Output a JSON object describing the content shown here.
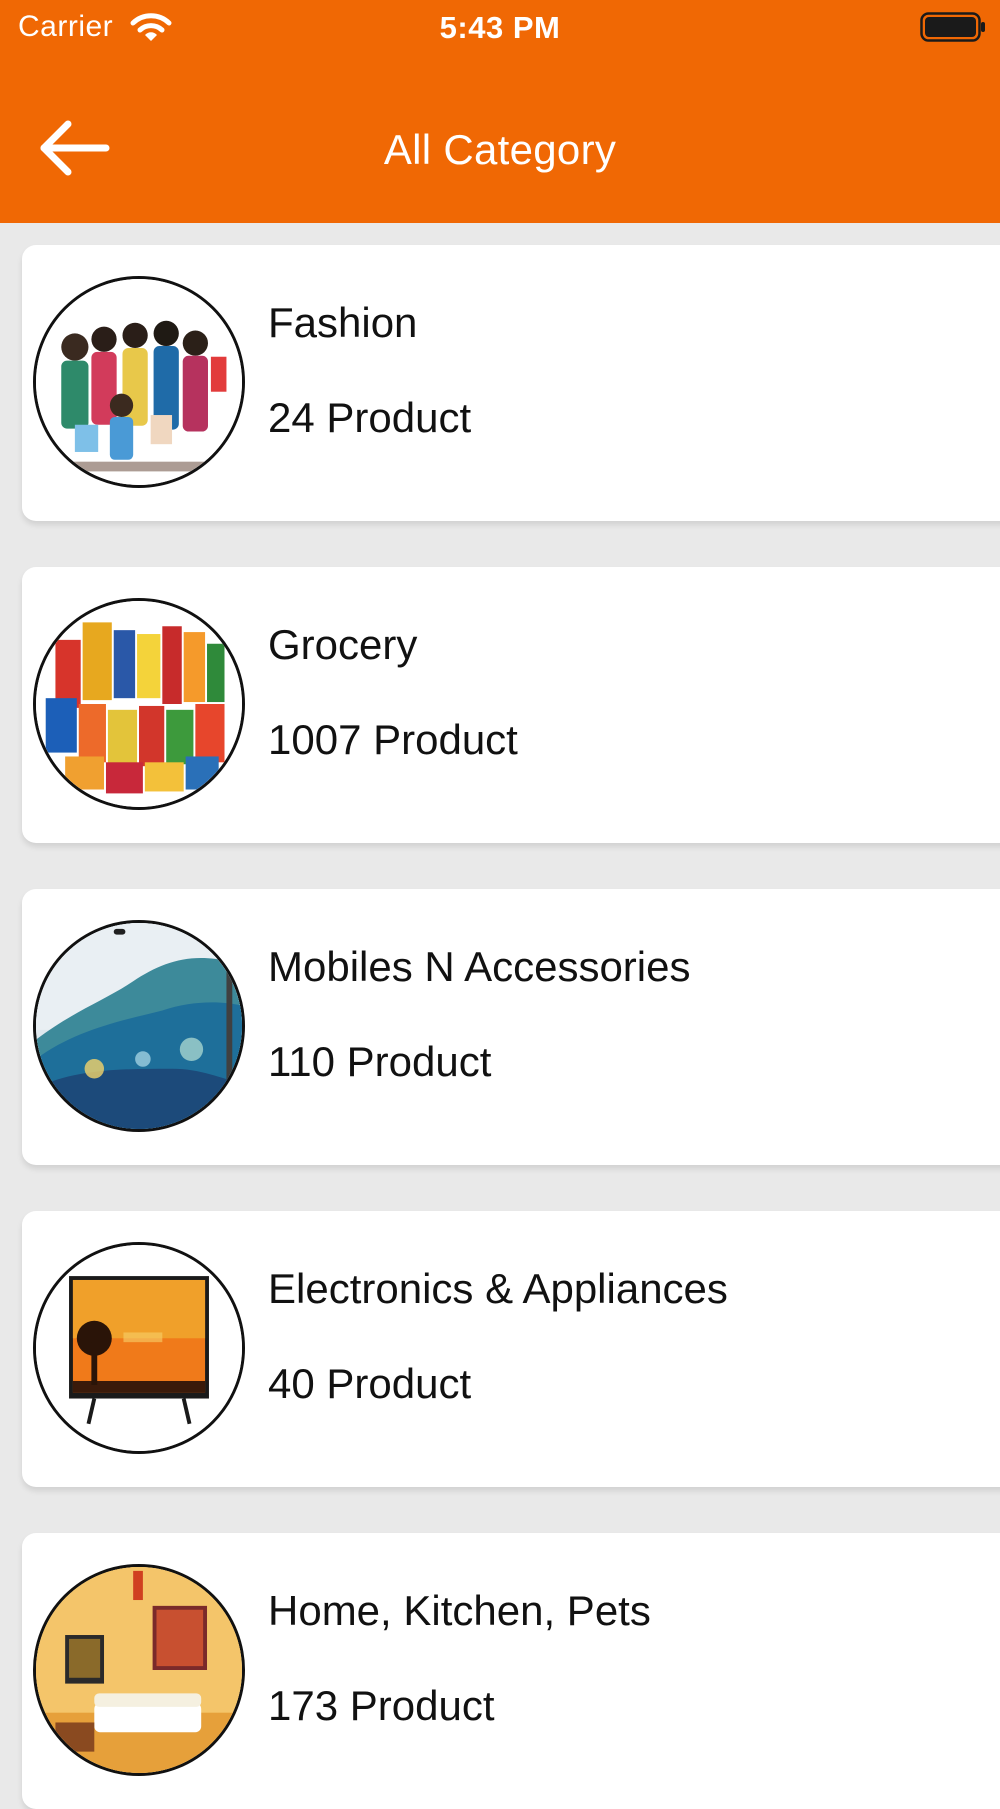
{
  "status_bar": {
    "carrier": "Carrier",
    "time": "5:43 PM",
    "wifi_icon": "wifi-icon",
    "battery_icon": "battery-icon"
  },
  "header": {
    "title": "All Category",
    "back_icon": "arrow-left-icon",
    "background_color": "#f06804"
  },
  "categories": [
    {
      "name": "Fashion",
      "count": "24 Product",
      "image": "fashion-family-photo"
    },
    {
      "name": "Grocery",
      "count": "1007 Product",
      "image": "grocery-products-photo"
    },
    {
      "name": "Mobiles N Accessories",
      "count": "110 Product",
      "image": "tv-screen-wave-photo"
    },
    {
      "name": "Electronics & Appliances",
      "count": "40 Product",
      "image": "television-sunset-photo"
    },
    {
      "name": "Home, Kitchen, Pets",
      "count": "173 Product",
      "image": "living-room-photo"
    }
  ]
}
